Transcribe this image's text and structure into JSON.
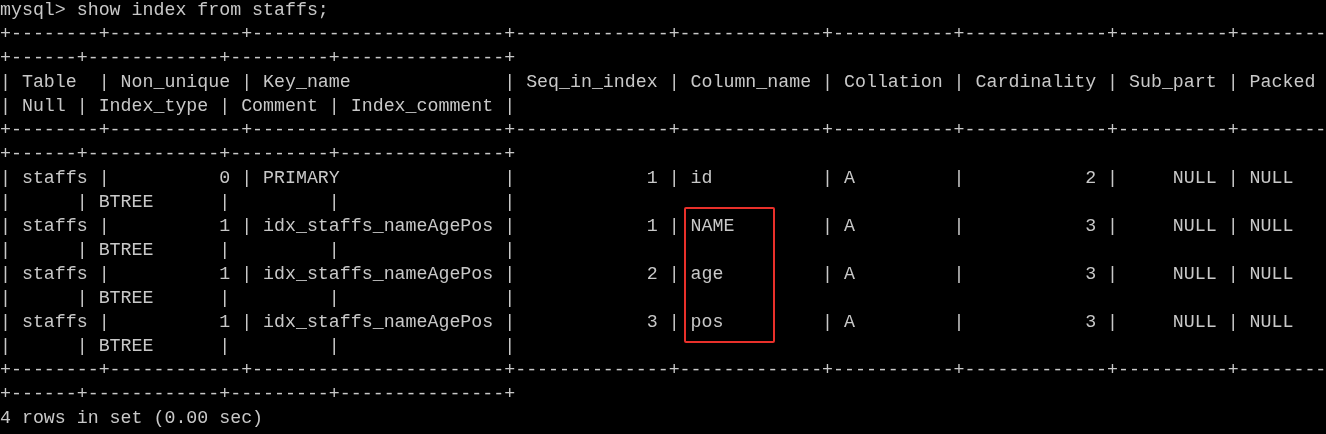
{
  "terminal": {
    "command": "mysql> show index from staffs;",
    "lines": [
      {
        "kind": "line",
        "text": "+--------+------------+-----------------------+--------------+-------------+-----------+-------------+----------+--------"
      },
      {
        "kind": "line",
        "text": "+------+------------+---------+---------------+"
      },
      {
        "kind": "line",
        "text": "| Table  | Non_unique | Key_name              | Seq_in_index | Column_name | Collation | Cardinality | Sub_part | Packed"
      },
      {
        "kind": "line",
        "text": "| Null | Index_type | Comment | Index_comment |"
      },
      {
        "kind": "line",
        "text": "+--------+------------+-----------------------+--------------+-------------+-----------+-------------+----------+--------"
      },
      {
        "kind": "line",
        "text": "+------+------------+---------+---------------+"
      },
      {
        "kind": "line",
        "text": "| staffs |          0 | PRIMARY               |            1 | id          | A         |           2 |     NULL | NULL"
      },
      {
        "kind": "line",
        "text": "|      | BTREE      |         |               |"
      },
      {
        "kind": "highlight",
        "color": "#e8302a",
        "lines": [
          {
            "text": "| staffs |          1 | idx_staffs_nameAgePos |            1 | NAME        | A         |           3 |     NULL | NULL"
          },
          {
            "text": "|      | BTREE      |         |               |"
          },
          {
            "text": "| staffs |          1 | idx_staffs_nameAgePos |            2 | age         | A         |           3 |     NULL | NULL"
          },
          {
            "text": "|      | BTREE      |         |               |"
          },
          {
            "text": "| staffs |          1 | idx_staffs_nameAgePos |            3 | pos         | A         |           3 |     NULL | NULL"
          }
        ]
      },
      {
        "kind": "line",
        "text": "|      | BTREE      |         |               |"
      },
      {
        "kind": "line",
        "text": "+--------+------------+-----------------------+--------------+-------------+-----------+-------------+----------+--------"
      },
      {
        "kind": "line",
        "text": "+------+------------+---------+---------------+"
      }
    ],
    "summary": "4 rows in set (0.00 sec)"
  }
}
